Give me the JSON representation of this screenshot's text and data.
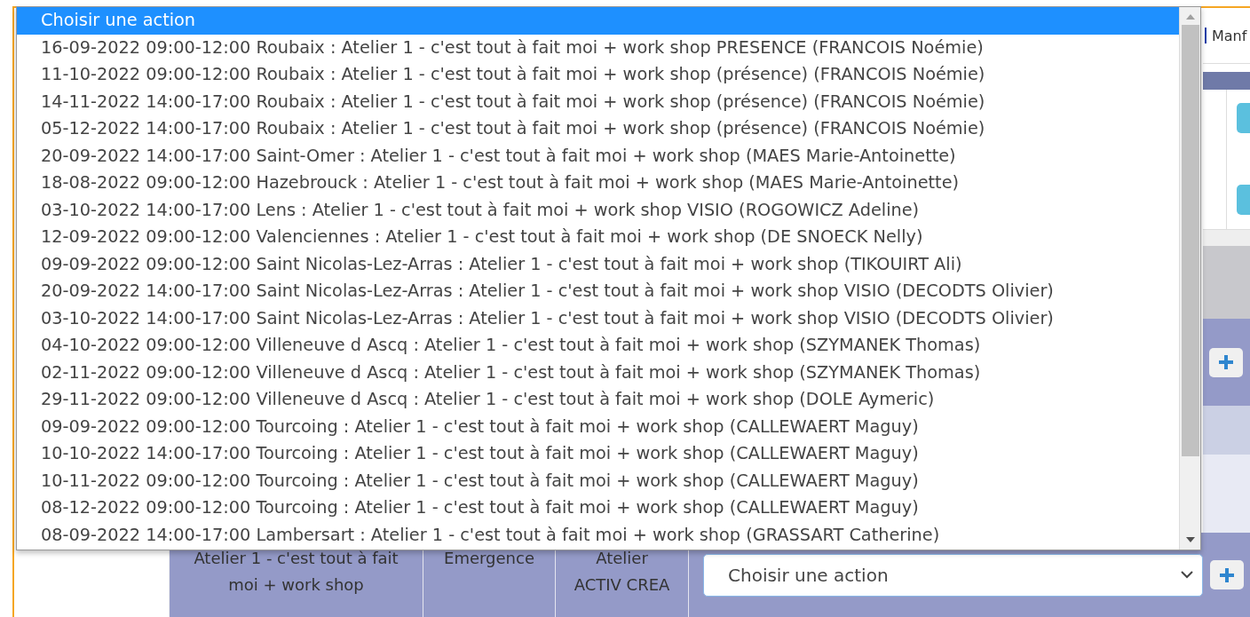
{
  "dropdown": {
    "options": [
      {
        "label": "Choisir une action",
        "selected": true
      },
      {
        "label": "16-09-2022 09:00-12:00 Roubaix : Atelier 1 - c'est tout à fait moi + work shop PRESENCE (FRANCOIS Noémie)",
        "selected": false
      },
      {
        "label": "11-10-2022 09:00-12:00 Roubaix : Atelier 1 - c'est tout à fait moi + work shop (présence) (FRANCOIS Noémie)",
        "selected": false
      },
      {
        "label": "14-11-2022 14:00-17:00 Roubaix : Atelier 1 - c'est tout à fait moi + work shop (présence) (FRANCOIS Noémie)",
        "selected": false
      },
      {
        "label": "05-12-2022 14:00-17:00 Roubaix : Atelier 1 - c'est tout à fait moi + work shop (présence) (FRANCOIS Noémie)",
        "selected": false
      },
      {
        "label": "20-09-2022 14:00-17:00 Saint-Omer : Atelier 1 - c'est tout à fait moi + work shop (MAES Marie-Antoinette)",
        "selected": false
      },
      {
        "label": "18-08-2022 09:00-12:00 Hazebrouck : Atelier 1 - c'est tout à fait moi + work shop (MAES Marie-Antoinette)",
        "selected": false
      },
      {
        "label": "03-10-2022 14:00-17:00 Lens : Atelier 1 - c'est tout à fait moi + work shop VISIO (ROGOWICZ Adeline)",
        "selected": false
      },
      {
        "label": "12-09-2022 09:00-12:00 Valenciennes : Atelier 1 - c'est tout à fait moi + work shop (DE SNOECK Nelly)",
        "selected": false
      },
      {
        "label": "09-09-2022 09:00-12:00 Saint Nicolas-Lez-Arras : Atelier 1 - c'est tout à fait moi + work shop (TIKOUIRT Ali)",
        "selected": false
      },
      {
        "label": "20-09-2022 14:00-17:00 Saint Nicolas-Lez-Arras : Atelier 1 - c'est tout à fait moi + work shop VISIO (DECODTS Olivier)",
        "selected": false
      },
      {
        "label": "03-10-2022 14:00-17:00 Saint Nicolas-Lez-Arras : Atelier 1 - c'est tout à fait moi + work shop VISIO (DECODTS Olivier)",
        "selected": false
      },
      {
        "label": "04-10-2022 09:00-12:00 Villeneuve d Ascq : Atelier 1 - c'est tout à fait moi + work shop (SZYMANEK Thomas)",
        "selected": false
      },
      {
        "label": "02-11-2022 09:00-12:00 Villeneuve d Ascq : Atelier 1 - c'est tout à fait moi + work shop (SZYMANEK Thomas)",
        "selected": false
      },
      {
        "label": "29-11-2022 09:00-12:00 Villeneuve d Ascq : Atelier 1 - c'est tout à fait moi + work shop (DOLE Aymeric)",
        "selected": false
      },
      {
        "label": "09-09-2022 09:00-12:00 Tourcoing : Atelier 1 - c'est tout à fait moi + work shop (CALLEWAERT Maguy)",
        "selected": false
      },
      {
        "label": "10-10-2022 14:00-17:00 Tourcoing : Atelier 1 - c'est tout à fait moi + work shop (CALLEWAERT Maguy)",
        "selected": false
      },
      {
        "label": "10-11-2022 09:00-12:00 Tourcoing : Atelier 1 - c'est tout à fait moi + work shop (CALLEWAERT Maguy)",
        "selected": false
      },
      {
        "label": "08-12-2022 09:00-12:00 Tourcoing : Atelier 1 - c'est tout à fait moi + work shop (CALLEWAERT Maguy)",
        "selected": false
      },
      {
        "label": "08-09-2022 14:00-17:00 Lambersart : Atelier 1 - c'est tout à fait moi + work shop (GRASSART Catherine)",
        "selected": false
      }
    ]
  },
  "background": {
    "header_text": "Manf",
    "table_row": {
      "cells": [
        "Atelier 1 - c'est tout à fait moi + work shop",
        "Emergence",
        "Atelier ACTIV CREA"
      ],
      "select": {
        "value": "Choisir une action"
      }
    }
  }
}
